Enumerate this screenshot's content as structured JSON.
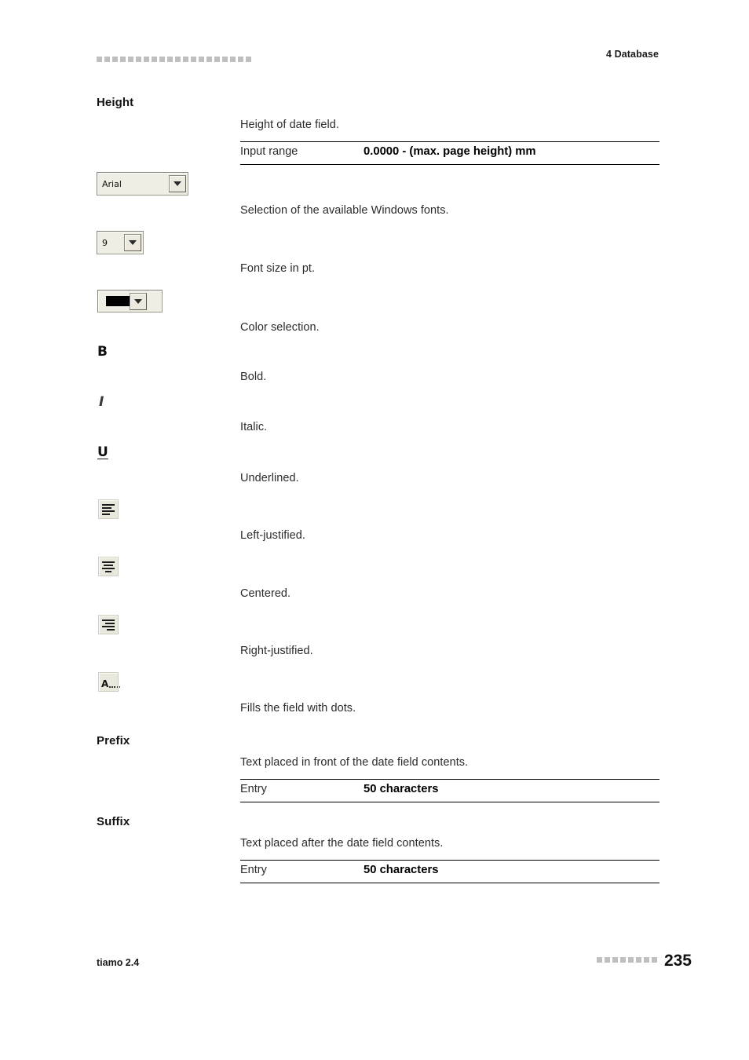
{
  "header": {
    "decor_squares": 20,
    "chapter": "4 Database"
  },
  "sections": [
    {
      "term": "Height",
      "description": "Height of date field.",
      "spec": {
        "label": "Input range",
        "value": "0.0000 - (max. page height) mm"
      }
    },
    {
      "term": "Prefix",
      "description": "Text placed in front of the date field contents.",
      "spec": {
        "label": "Entry",
        "value": "50 characters"
      }
    },
    {
      "term": "Suffix",
      "description": "Text placed after the date field contents.",
      "spec": {
        "label": "Entry",
        "value": "50 characters"
      }
    }
  ],
  "controls": {
    "font_family": {
      "icon": "dropdown-combobox",
      "value": "Arial",
      "description": "Selection of the available Windows fonts."
    },
    "font_size": {
      "icon": "dropdown-combobox",
      "value": "9",
      "description": "Font size in pt."
    },
    "font_color": {
      "icon": "color-swatch-dropdown",
      "value": "",
      "swatch_color": "#000000",
      "description": "Color selection."
    },
    "bold": {
      "icon": "bold-icon",
      "glyph": "B",
      "description": "Bold."
    },
    "italic": {
      "icon": "italic-icon",
      "glyph": "I",
      "description": "Italic."
    },
    "underline": {
      "icon": "underline-icon",
      "glyph": "U",
      "description": "Underlined."
    },
    "align_left": {
      "icon": "align-left-icon",
      "description": "Left-justified."
    },
    "align_center": {
      "icon": "align-center-icon",
      "description": "Centered."
    },
    "align_right": {
      "icon": "align-right-icon",
      "description": "Right-justified."
    },
    "fill_dots": {
      "icon": "fill-with-dots-icon",
      "glyph": "A",
      "description": "Fills the field with dots."
    }
  },
  "footer": {
    "product": "tiamo 2.4",
    "decor_squares": 8,
    "page_number": "235"
  },
  "colors": {
    "text": "#2b2b2b",
    "heading": "#141414",
    "rule": "#000000",
    "decor": "#bfbfbf",
    "control_face": "#efeee4"
  }
}
